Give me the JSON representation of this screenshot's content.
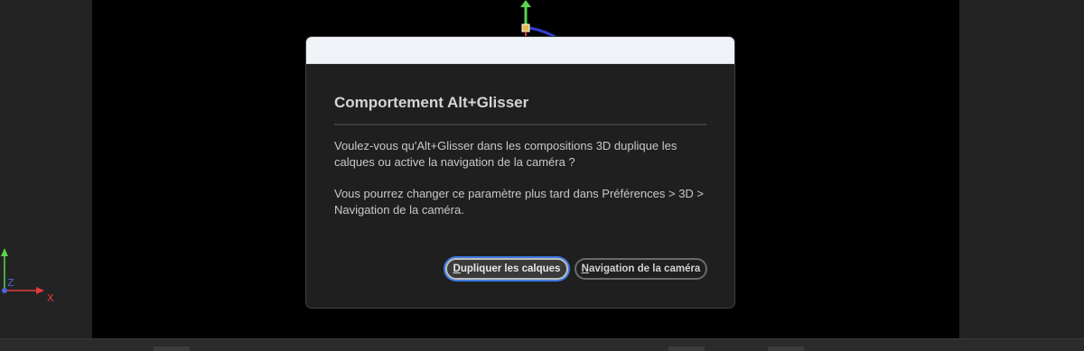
{
  "dialog": {
    "heading": "Comportement Alt+Glisser",
    "paragraph1": "Voulez-vous qu'Alt+Glisser dans les compositions 3D duplique les calques ou active la navigation de la caméra ?",
    "paragraph2": "Vous pourrez changer ce paramètre plus tard dans Préférences > 3D > Navigation de la caméra.",
    "buttons": {
      "duplicate_mnemonic": "D",
      "duplicate_rest": "upliquer les calques",
      "navigation_mnemonic": "N",
      "navigation_rest": "avigation de la caméra"
    }
  },
  "axis_indicator": {
    "x_label": "X",
    "z_label": "Z"
  },
  "colors": {
    "viewport": "#000000",
    "dialog_bg": "#1f1f1f",
    "titlebar": "#f0f4f8",
    "focus_ring": "#3c7be0",
    "axis_x": "#e23b3b",
    "axis_y": "#5bd44b",
    "axis_z": "#4a68d8"
  }
}
